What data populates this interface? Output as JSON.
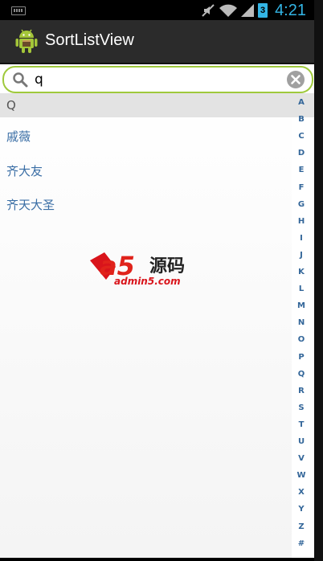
{
  "status_bar": {
    "time": "4:21",
    "battery_label": "3",
    "icons": [
      "keyboard-icon",
      "mute-icon",
      "wifi-icon",
      "signal-icon",
      "battery-icon"
    ],
    "accent_color": "#33b5e5"
  },
  "action_bar": {
    "title": "SortListView",
    "icon": "android-icon"
  },
  "search": {
    "value": "q",
    "icon": "search-icon",
    "clear_icon": "clear-icon",
    "border_color": "#9fc93c"
  },
  "list": {
    "section_letter": "Q",
    "items": [
      "戚薇",
      "齐大友",
      "齐天大圣"
    ]
  },
  "sidebar": {
    "letters": [
      "A",
      "B",
      "C",
      "D",
      "E",
      "F",
      "G",
      "H",
      "I",
      "J",
      "K",
      "L",
      "M",
      "N",
      "O",
      "P",
      "Q",
      "R",
      "S",
      "T",
      "U",
      "V",
      "W",
      "X",
      "Y",
      "Z",
      "#"
    ]
  },
  "watermark": {
    "logo_text": "a5",
    "chinese_text": "源码",
    "url_text": "admin5.com"
  }
}
